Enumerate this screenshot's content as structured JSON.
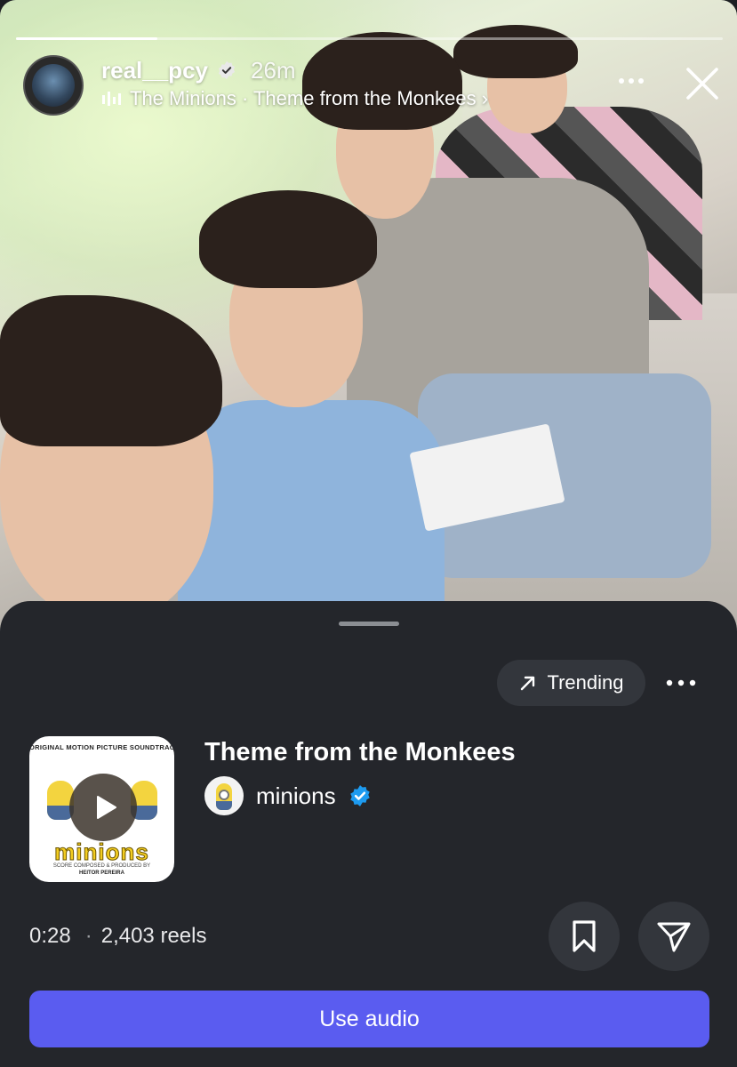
{
  "story": {
    "progress": 0.2,
    "username": "real__pcy",
    "time_ago": "26m",
    "music_text": "The Minions · Theme from the Monkees ›",
    "icons": {
      "verified": "verified-badge-icon",
      "music": "music-bars-icon",
      "more": "more-horizontal-icon",
      "close": "close-icon"
    }
  },
  "sheet": {
    "trending_label": "Trending",
    "cover": {
      "top_text": "ORIGINAL MOTION PICTURE SOUNDTRACK",
      "logo_text": "minions",
      "credit_line1": "SCORE COMPOSED & PRODUCED BY",
      "credit_line2": "HEITOR PEREIRA"
    },
    "song_title": "Theme from the Monkees",
    "artist_name": "minions",
    "duration": "0:28",
    "reels_count": "2,403 reels",
    "use_audio_label": "Use audio",
    "colors": {
      "accent": "#5a5cf0",
      "verified": "#1d9bf0",
      "sheet_bg": "#24262b"
    }
  }
}
